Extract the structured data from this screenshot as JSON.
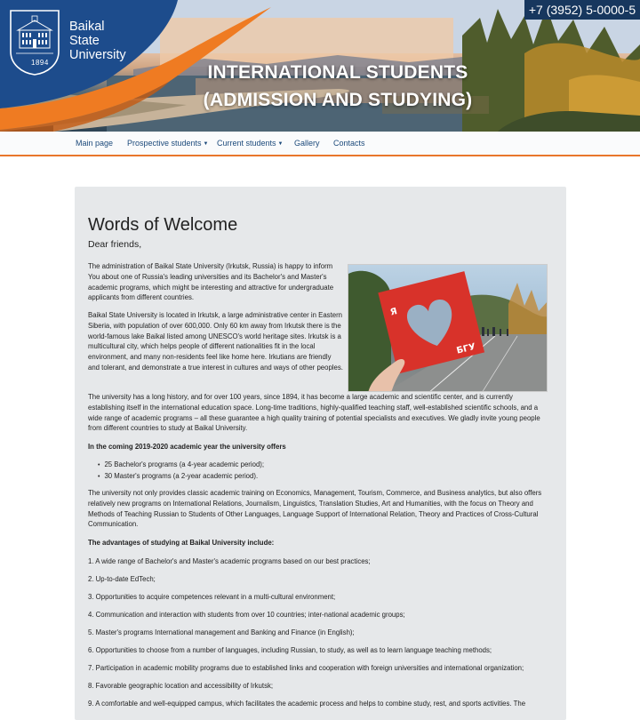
{
  "header": {
    "logo": {
      "name_lines": [
        "Baikal",
        "State",
        "University"
      ],
      "year": "1894"
    },
    "phone": "+7 (3952) 5-0000-5",
    "title_lines": [
      "INTERNATIONAL STUDENTS",
      "(ADMISSION AND STUDYING)"
    ]
  },
  "nav": {
    "items": [
      {
        "label": "Main page",
        "has_dropdown": false
      },
      {
        "label": "Prospective students",
        "has_dropdown": true
      },
      {
        "label": "Current students",
        "has_dropdown": true
      },
      {
        "label": "Gallery",
        "has_dropdown": false
      },
      {
        "label": "Contacts",
        "has_dropdown": false
      }
    ]
  },
  "content": {
    "title": "Words of Welcome",
    "greeting": "Dear friends,",
    "paragraph_1": "The administration of Baikal State University (Irkutsk, Russia) is happy to inform You about one of Russia's leading universities and its Bachelor's and Master's academic programs, which might be interesting and attractive for undergraduate applicants from different countries.",
    "paragraph_2": "Baikal State University is located in Irkutsk, a large administrative center in Eastern Siberia, with population of over 600,000. Only 60 km away from Irkutsk there is the world-famous lake Baikal listed among UNESCO's world heritage sites. Irkutsk is a multicultural city, which helps people of different nationalities fit in the local environment, and many non-residents feel like home here. Irkutians are friendly and tolerant, and demonstrate a true interest in cultures and ways of other peoples.",
    "paragraph_3": "The university has a long history, and for over 100 years, since 1894, it has become a large academic and scientific center, and is currently establishing itself in the international education space. Long-time traditions, highly-qualified teaching staff, well-established scientific schools, and a wide range of academic programs – all these guarantee a high quality training of potential specialists and executives. We gladly invite young people from different countries to study at Baikal University.",
    "offers_heading": "In the coming 2019-2020 academic year the university offers",
    "offers": [
      "25 Bachelor's programs (a 4-year academic period);",
      "30 Master's programs (a 2-year academic period)."
    ],
    "paragraph_4": "The university not only provides classic academic training on Economics, Management, Tourism, Commerce, and Business analytics, but also offers relatively new programs on International Relations, Journalism, Linguistics, Translation Studies, Art and Humanities, with the focus on Theory and Methods of Teaching Russian to Students of Other Languages, Language Support of International Relation, Theory and Practices of Cross-Cultural Communication.",
    "advantages_heading": "The advantages of studying at Baikal University include:",
    "advantages": [
      "1. A wide range of Bachelor's and Master's academic programs based on our best practices;",
      "2. Up-to-date EdTech;",
      "3. Opportunities to acquire competences relevant in a multi-cultural environment;",
      "4. Communication and interaction with students from over 10 countries; inter-national academic groups;",
      "5. Master's programs International management and Banking and Finance (in English);",
      "6. Opportunities to choose from a number of languages, including Russian, to study, as well as to learn language teaching methods;",
      "7. Participation in academic mobility programs due to established links and cooperation with foreign universities and international organization;",
      "8. Favorable geographic location and accessibility of Irkutsk;",
      "9. A comfortable and well-equipped campus, which facilitates the academic process and helps to combine study, rest, and sports activities. The"
    ],
    "photo_frame_letters": {
      "left": "Я",
      "right": "БГУ"
    }
  },
  "colors": {
    "brand_blue": "#1c4a7b",
    "phone_bg": "#17375e",
    "accent_orange": "#e9762b",
    "card_bg": "#e6e8ea",
    "frame_red": "#d8322a"
  }
}
